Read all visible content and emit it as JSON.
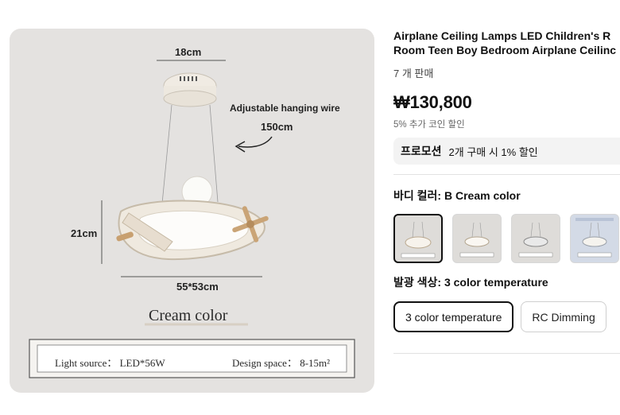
{
  "product": {
    "title_line1": "Airplane Ceiling Lamps LED Children's R",
    "title_line2": "Room Teen Boy Bedroom Airplane Ceilinc",
    "sold_count": "7 개 판매",
    "price": "₩130,800",
    "coin_discount": "5% 추가 코인 할인",
    "promotion": {
      "tag": "프로모션",
      "text": "2개 구매 시 1% 할인"
    }
  },
  "image": {
    "top_width": "18cm",
    "hanging_wire_label": "Adjustable hanging wire",
    "wire_length": "150cm",
    "height": "21cm",
    "body_size": "55*53cm",
    "color_caption": "Cream color",
    "light_source": "Light source： LED*56W",
    "design_space": "Design space： 8-15m²"
  },
  "body_color": {
    "label": "바디 컬러: ",
    "value": "B Cream color",
    "thumbnails": [
      "option-1",
      "option-2",
      "option-3",
      "option-4"
    ]
  },
  "light_color": {
    "label": "발광 색상: ",
    "value": "3 color temperature",
    "options": [
      "3 color temperature",
      "RC Dimming"
    ]
  }
}
